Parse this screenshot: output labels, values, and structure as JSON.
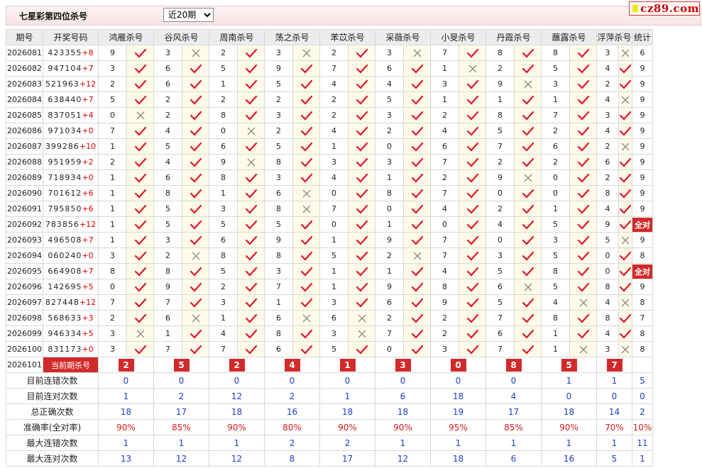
{
  "header": {
    "title": "七星彩第四位杀号",
    "period_select": "近20期",
    "logo": "cz89.com"
  },
  "columns": [
    "期号",
    "开奖号码",
    "鸿雁杀号",
    "谷风杀号",
    "周南杀号",
    "荡之杀号",
    "苯苡杀号",
    "采薇杀号",
    "小旻杀号",
    "丹霞杀号",
    "蘸露杀号",
    "浮萍杀号",
    "统计"
  ],
  "rows": [
    {
      "p": "2026081",
      "d": "423355",
      "s": "+8",
      "k": [
        [
          "9",
          1
        ],
        [
          "3",
          0
        ],
        [
          "2",
          1
        ],
        [
          "3",
          0
        ],
        [
          "2",
          1
        ],
        [
          "3",
          0
        ],
        [
          "7",
          1
        ],
        [
          "8",
          1
        ],
        [
          "8",
          1
        ],
        [
          "3",
          0
        ]
      ],
      "t": "6"
    },
    {
      "p": "2026082",
      "d": "947104",
      "s": "+7",
      "k": [
        [
          "3",
          1
        ],
        [
          "6",
          1
        ],
        [
          "5",
          1
        ],
        [
          "9",
          1
        ],
        [
          "7",
          1
        ],
        [
          "6",
          1
        ],
        [
          "1",
          0
        ],
        [
          "2",
          1
        ],
        [
          "5",
          1
        ],
        [
          "4",
          1
        ]
      ],
      "t": "9"
    },
    {
      "p": "2026083",
      "d": "521963",
      "s": "+12",
      "k": [
        [
          "2",
          1
        ],
        [
          "6",
          1
        ],
        [
          "1",
          1
        ],
        [
          "5",
          1
        ],
        [
          "4",
          1
        ],
        [
          "4",
          1
        ],
        [
          "3",
          1
        ],
        [
          "9",
          0
        ],
        [
          "3",
          1
        ],
        [
          "2",
          1
        ]
      ],
      "t": "9"
    },
    {
      "p": "2026084",
      "d": "638440",
      "s": "+7",
      "k": [
        [
          "5",
          1
        ],
        [
          "2",
          1
        ],
        [
          "2",
          1
        ],
        [
          "2",
          1
        ],
        [
          "2",
          1
        ],
        [
          "5",
          1
        ],
        [
          "1",
          1
        ],
        [
          "1",
          1
        ],
        [
          "1",
          1
        ],
        [
          "4",
          0
        ]
      ],
      "t": "9"
    },
    {
      "p": "2026085",
      "d": "837051",
      "s": "+4",
      "k": [
        [
          "0",
          0
        ],
        [
          "2",
          1
        ],
        [
          "8",
          1
        ],
        [
          "3",
          1
        ],
        [
          "2",
          1
        ],
        [
          "3",
          1
        ],
        [
          "2",
          1
        ],
        [
          "8",
          1
        ],
        [
          "7",
          1
        ],
        [
          "3",
          1
        ]
      ],
      "t": "9"
    },
    {
      "p": "2026086",
      "d": "971034",
      "s": "+0",
      "k": [
        [
          "7",
          1
        ],
        [
          "4",
          1
        ],
        [
          "0",
          0
        ],
        [
          "2",
          1
        ],
        [
          "4",
          1
        ],
        [
          "2",
          1
        ],
        [
          "4",
          1
        ],
        [
          "5",
          1
        ],
        [
          "2",
          1
        ],
        [
          "4",
          1
        ]
      ],
      "t": "9"
    },
    {
      "p": "2026087",
      "d": "399286",
      "s": "+10",
      "k": [
        [
          "1",
          1
        ],
        [
          "5",
          1
        ],
        [
          "6",
          1
        ],
        [
          "5",
          1
        ],
        [
          "1",
          1
        ],
        [
          "0",
          1
        ],
        [
          "6",
          1
        ],
        [
          "7",
          1
        ],
        [
          "6",
          1
        ],
        [
          "2",
          0
        ]
      ],
      "t": "9"
    },
    {
      "p": "2026088",
      "d": "951959",
      "s": "+2",
      "k": [
        [
          "2",
          1
        ],
        [
          "4",
          1
        ],
        [
          "9",
          0
        ],
        [
          "8",
          1
        ],
        [
          "3",
          1
        ],
        [
          "3",
          1
        ],
        [
          "7",
          1
        ],
        [
          "2",
          1
        ],
        [
          "2",
          1
        ],
        [
          "6",
          1
        ]
      ],
      "t": "9"
    },
    {
      "p": "2026089",
      "d": "718934",
      "s": "+0",
      "k": [
        [
          "1",
          1
        ],
        [
          "6",
          1
        ],
        [
          "8",
          1
        ],
        [
          "3",
          1
        ],
        [
          "4",
          1
        ],
        [
          "1",
          1
        ],
        [
          "2",
          1
        ],
        [
          "9",
          0
        ],
        [
          "0",
          1
        ],
        [
          "2",
          1
        ]
      ],
      "t": "9"
    },
    {
      "p": "2026090",
      "d": "701612",
      "s": "+6",
      "k": [
        [
          "1",
          1
        ],
        [
          "8",
          1
        ],
        [
          "1",
          1
        ],
        [
          "6",
          0
        ],
        [
          "0",
          1
        ],
        [
          "8",
          1
        ],
        [
          "7",
          1
        ],
        [
          "0",
          1
        ],
        [
          "0",
          1
        ],
        [
          "8",
          1
        ]
      ],
      "t": "9"
    },
    {
      "p": "2026091",
      "d": "795850",
      "s": "+6",
      "k": [
        [
          "1",
          1
        ],
        [
          "5",
          1
        ],
        [
          "3",
          1
        ],
        [
          "8",
          0
        ],
        [
          "7",
          1
        ],
        [
          "0",
          1
        ],
        [
          "4",
          1
        ],
        [
          "2",
          1
        ],
        [
          "1",
          1
        ],
        [
          "4",
          1
        ]
      ],
      "t": "9"
    },
    {
      "p": "2026092",
      "d": "783856",
      "s": "+12",
      "k": [
        [
          "1",
          1
        ],
        [
          "5",
          1
        ],
        [
          "5",
          1
        ],
        [
          "5",
          1
        ],
        [
          "0",
          1
        ],
        [
          "1",
          1
        ],
        [
          "0",
          1
        ],
        [
          "4",
          1
        ],
        [
          "5",
          1
        ],
        [
          "9",
          1
        ]
      ],
      "t": "全对"
    },
    {
      "p": "2026093",
      "d": "496508",
      "s": "+7",
      "k": [
        [
          "1",
          1
        ],
        [
          "3",
          1
        ],
        [
          "6",
          1
        ],
        [
          "9",
          1
        ],
        [
          "1",
          1
        ],
        [
          "9",
          1
        ],
        [
          "7",
          1
        ],
        [
          "0",
          1
        ],
        [
          "3",
          1
        ],
        [
          "5",
          0
        ]
      ],
      "t": "9"
    },
    {
      "p": "2026094",
      "d": "060240",
      "s": "+0",
      "k": [
        [
          "3",
          1
        ],
        [
          "2",
          0
        ],
        [
          "8",
          1
        ],
        [
          "8",
          1
        ],
        [
          "5",
          1
        ],
        [
          "2",
          0
        ],
        [
          "7",
          1
        ],
        [
          "3",
          1
        ],
        [
          "5",
          1
        ],
        [
          "0",
          1
        ]
      ],
      "t": "8"
    },
    {
      "p": "2026095",
      "d": "664908",
      "s": "+7",
      "k": [
        [
          "8",
          1
        ],
        [
          "8",
          1
        ],
        [
          "5",
          1
        ],
        [
          "3",
          1
        ],
        [
          "1",
          1
        ],
        [
          "1",
          1
        ],
        [
          "4",
          1
        ],
        [
          "5",
          1
        ],
        [
          "8",
          1
        ],
        [
          "0",
          1
        ]
      ],
      "t": "全对"
    },
    {
      "p": "2026096",
      "d": "142695",
      "s": "+5",
      "k": [
        [
          "0",
          1
        ],
        [
          "9",
          1
        ],
        [
          "2",
          1
        ],
        [
          "7",
          1
        ],
        [
          "1",
          1
        ],
        [
          "9",
          1
        ],
        [
          "8",
          1
        ],
        [
          "6",
          0
        ],
        [
          "5",
          1
        ],
        [
          "8",
          1
        ]
      ],
      "t": "9"
    },
    {
      "p": "2026097",
      "d": "827448",
      "s": "+12",
      "k": [
        [
          "7",
          1
        ],
        [
          "7",
          1
        ],
        [
          "3",
          1
        ],
        [
          "1",
          1
        ],
        [
          "3",
          1
        ],
        [
          "6",
          1
        ],
        [
          "9",
          1
        ],
        [
          "5",
          1
        ],
        [
          "4",
          0
        ],
        [
          "4",
          0
        ]
      ],
      "t": "8"
    },
    {
      "p": "2026098",
      "d": "568633",
      "s": "+3",
      "k": [
        [
          "2",
          1
        ],
        [
          "6",
          0
        ],
        [
          "1",
          1
        ],
        [
          "6",
          0
        ],
        [
          "6",
          0
        ],
        [
          "2",
          1
        ],
        [
          "2",
          1
        ],
        [
          "7",
          1
        ],
        [
          "8",
          1
        ],
        [
          "8",
          1
        ]
      ],
      "t": "7"
    },
    {
      "p": "2026099",
      "d": "946334",
      "s": "+5",
      "k": [
        [
          "3",
          0
        ],
        [
          "1",
          1
        ],
        [
          "4",
          1
        ],
        [
          "8",
          1
        ],
        [
          "3",
          0
        ],
        [
          "7",
          1
        ],
        [
          "2",
          1
        ],
        [
          "6",
          1
        ],
        [
          "1",
          1
        ],
        [
          "4",
          1
        ]
      ],
      "t": "8"
    },
    {
      "p": "2026100",
      "d": "831173",
      "s": "+0",
      "k": [
        [
          "3",
          1
        ],
        [
          "7",
          1
        ],
        [
          "7",
          1
        ],
        [
          "6",
          1
        ],
        [
          "5",
          1
        ],
        [
          "0",
          1
        ],
        [
          "3",
          1
        ],
        [
          "7",
          1
        ],
        [
          "1",
          0
        ],
        [
          "3",
          0
        ]
      ],
      "t": "8"
    }
  ],
  "current": {
    "period": "2026101",
    "label": "当前期杀号",
    "values": [
      "2",
      "5",
      "2",
      "4",
      "1",
      "3",
      "0",
      "8",
      "5",
      "7"
    ]
  },
  "summary": [
    {
      "label": "目前连错次数",
      "values": [
        "0",
        "0",
        "0",
        "0",
        "0",
        "0",
        "0",
        "0",
        "1",
        "1",
        "5"
      ],
      "color": "blue"
    },
    {
      "label": "目前连对次数",
      "values": [
        "1",
        "2",
        "12",
        "2",
        "1",
        "6",
        "18",
        "4",
        "0",
        "0",
        "0"
      ],
      "color": "blue"
    },
    {
      "label": "总正确次数",
      "values": [
        "18",
        "17",
        "18",
        "16",
        "18",
        "18",
        "19",
        "17",
        "18",
        "14",
        "2"
      ],
      "color": "blue"
    },
    {
      "label": "准确率(全对率)",
      "values": [
        "90%",
        "85%",
        "90%",
        "80%",
        "90%",
        "90%",
        "95%",
        "85%",
        "90%",
        "70%",
        "10%"
      ],
      "color": "red"
    },
    {
      "label": "最大连错次数",
      "values": [
        "1",
        "1",
        "1",
        "2",
        "2",
        "1",
        "1",
        "1",
        "1",
        "1",
        "11"
      ],
      "color": "blue"
    },
    {
      "label": "最大连对次数",
      "values": [
        "13",
        "12",
        "12",
        "8",
        "17",
        "12",
        "18",
        "6",
        "16",
        "5",
        "1"
      ],
      "color": "blue"
    }
  ],
  "colors": {
    "check": "#e0152c",
    "cross": "#888888",
    "badge": "#d12a2a",
    "blue": "#1a3fcf"
  }
}
